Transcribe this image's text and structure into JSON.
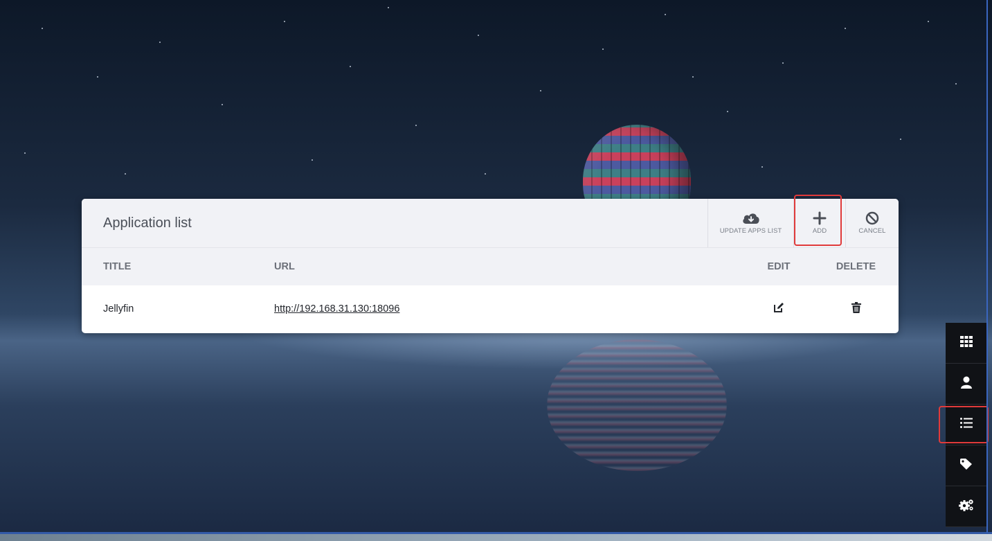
{
  "panel": {
    "title": "Application list",
    "actions": {
      "update_label": "UPDATE APPS LIST",
      "add_label": "ADD",
      "cancel_label": "CANCEL"
    }
  },
  "table": {
    "columns": {
      "title": "TITLE",
      "url": "URL",
      "edit": "EDIT",
      "delete": "DELETE"
    },
    "rows": [
      {
        "title": "Jellyfin",
        "url": "http://192.168.31.130:18096"
      }
    ]
  },
  "sidebar": {
    "items": [
      {
        "name": "apps",
        "icon": "grid-icon"
      },
      {
        "name": "user",
        "icon": "user-icon"
      },
      {
        "name": "list",
        "icon": "list-icon"
      },
      {
        "name": "tags",
        "icon": "tag-icon"
      },
      {
        "name": "settings",
        "icon": "gears-icon"
      }
    ]
  },
  "colors": {
    "highlight": "#e03a3a",
    "panel_header": "#f1f2f6",
    "sidebar": "#101216"
  }
}
